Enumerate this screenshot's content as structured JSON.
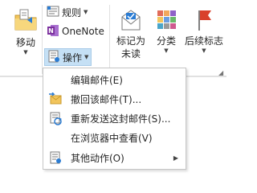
{
  "ribbon": {
    "move": {
      "label": "移动",
      "icon": "move-to-folder-icon"
    },
    "rules": {
      "label": "规则",
      "icon": "rules-icon"
    },
    "onenote": {
      "label": "OneNote",
      "icon": "onenote-icon"
    },
    "actions": {
      "label": "操作",
      "icon": "actions-icon",
      "expanded": true
    },
    "mark_unread": {
      "label_line1": "标记为",
      "label_line2": "未读",
      "icon": "mark-unread-icon"
    },
    "categorize": {
      "label": "分类",
      "icon": "categorize-icon"
    },
    "follow_up": {
      "label": "后续标志",
      "icon": "flag-icon"
    }
  },
  "menu": {
    "items": [
      {
        "label": "编辑邮件(E)",
        "icon": ""
      },
      {
        "label": "撤回该邮件(T)...",
        "icon": "recall-message-icon"
      },
      {
        "label": "重新发送这封邮件(S)...",
        "icon": "resend-message-icon"
      },
      {
        "label": "在浏览器中查看(V)",
        "icon": ""
      },
      {
        "label": "其他动作(O)",
        "icon": "other-actions-icon",
        "submenu": true
      }
    ]
  },
  "colors": {
    "accent_blue": "#2b7cd3",
    "folder_yellow": "#f2c55c",
    "onenote_purple": "#7b2f9e",
    "flag_red": "#d9412b",
    "hover_blue": "#c5e0f5"
  }
}
